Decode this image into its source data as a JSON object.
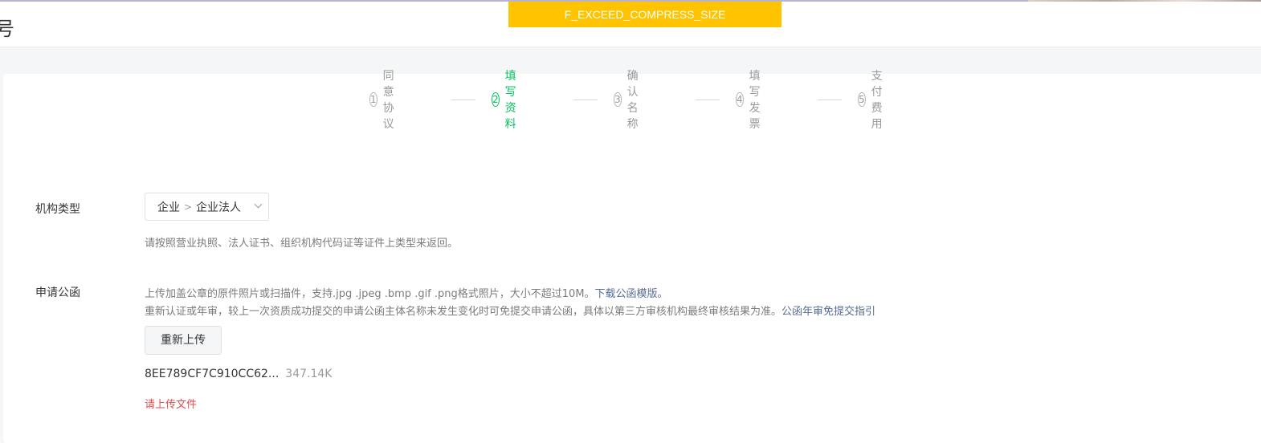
{
  "header": {
    "title": "号"
  },
  "toast": {
    "text": "F_EXCEED_COMPRESS_SIZE"
  },
  "steps": [
    {
      "num": "1",
      "label": "同意协议"
    },
    {
      "num": "2",
      "label": "填写资料",
      "active": true
    },
    {
      "num": "3",
      "label": "确认名称"
    },
    {
      "num": "4",
      "label": "填写发票"
    },
    {
      "num": "5",
      "label": "支付费用"
    }
  ],
  "org_type": {
    "label": "机构类型",
    "value_1": "企业",
    "value_2": "企业法人",
    "hint": "请按照营业执照、法人证书、组织机构代码证等证件上类型来返回。"
  },
  "letter": {
    "label": "申请公函",
    "hint_1": "上传加盖公章的原件照片或扫描件，支持.jpg .jpeg .bmp .gif .png格式照片，大小不超过10M。",
    "template_link": "下载公函模版。",
    "hint_2": "重新认证或年审，较上一次资质成功提交的申请公函主体名称未发生变化时可免提交申请公函，具体以第三方审核机构最终审核结果为准。",
    "guide_link": "公函年审免提交指引",
    "reupload_button": "重新上传",
    "file_name": "8EE789CF7C910CC62...",
    "file_size": "347.14K",
    "error": "请上传文件"
  },
  "colors": {
    "active": "#07c160",
    "link": "#576b95",
    "error": "#e24c4c",
    "toast": "#ffc300"
  }
}
